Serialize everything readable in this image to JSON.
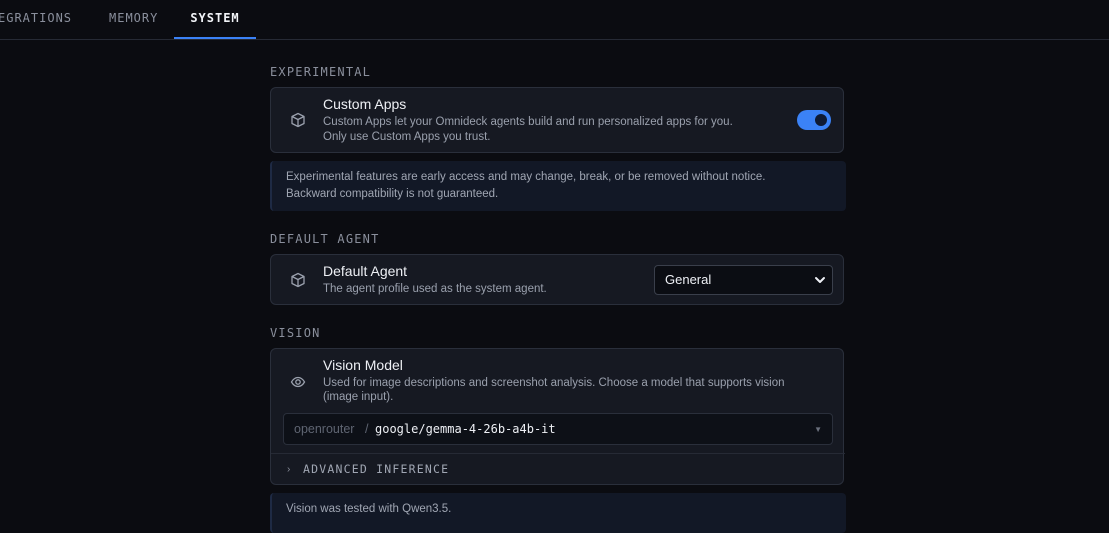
{
  "tabs": [
    {
      "label": "EGRATIONS"
    },
    {
      "label": "MEMORY"
    },
    {
      "label": "SYSTEM",
      "active": true
    }
  ],
  "experimental": {
    "section_title": "EXPERIMENTAL",
    "card_title": "Custom Apps",
    "card_desc_line1": "Custom Apps let your Omnideck agents build and run personalized apps for you.",
    "card_desc_line2": "Only use Custom Apps you trust.",
    "toggle_on": true,
    "note_line1": "Experimental features are early access and may change, break, or be removed without notice.",
    "note_line2": "Backward compatibility is not guaranteed."
  },
  "default_agent": {
    "section_title": "DEFAULT AGENT",
    "card_title": "Default Agent",
    "card_desc": "The agent profile used as the system agent.",
    "selected": "General"
  },
  "vision": {
    "section_title": "VISION",
    "card_title": "Vision Model",
    "card_desc_line1": "Used for image descriptions and screenshot analysis. Choose a model that supports vision",
    "card_desc_line2": "(image input).",
    "provider": "openrouter",
    "separator": "/",
    "model": "google/gemma-4-26b-a4b-it",
    "advanced_label": "ADVANCED INFERENCE",
    "note": "Vision was tested with Qwen3.5."
  },
  "colors": {
    "background": "#0b0c11",
    "card": "#161922",
    "accent": "#3b82f6"
  }
}
